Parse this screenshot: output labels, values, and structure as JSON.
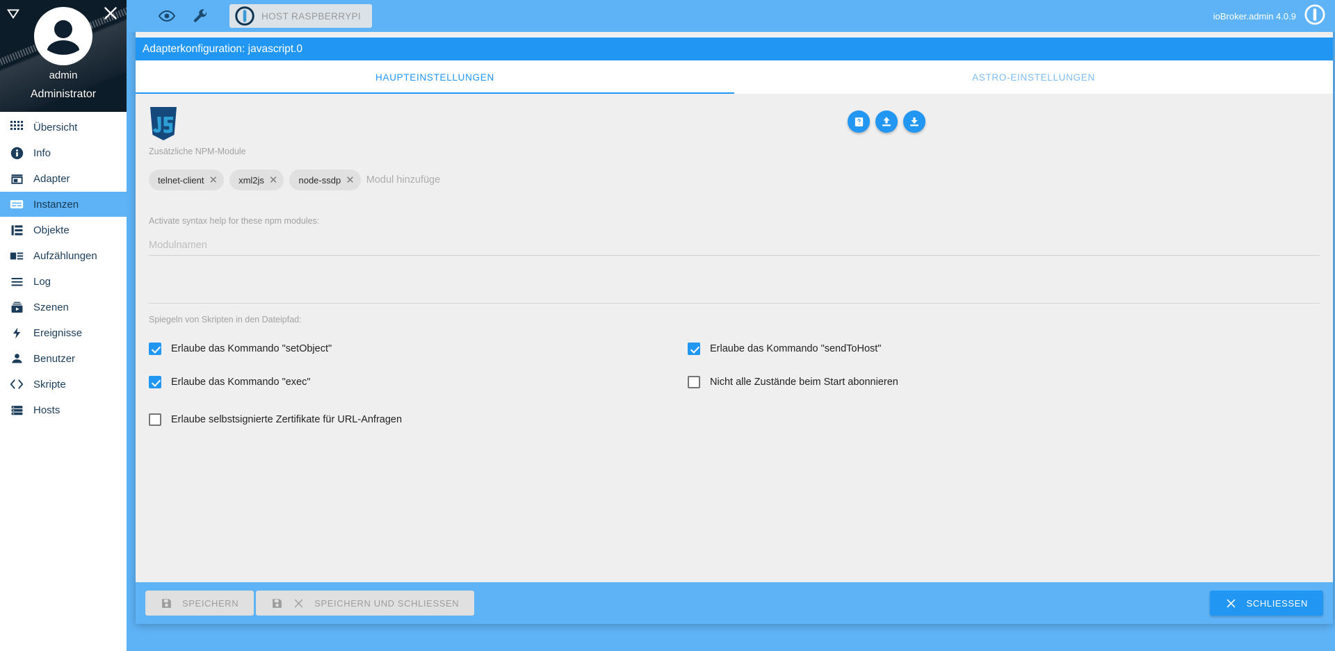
{
  "sidebar": {
    "user": {
      "name": "admin",
      "role": "Administrator"
    },
    "collapse_icon": "triangle-down-icon",
    "close_icon": "close-icon",
    "avatar_icon": "user-avatar-icon",
    "items": [
      {
        "label": "Übersicht",
        "icon": "grid-icon",
        "active": false
      },
      {
        "label": "Info",
        "icon": "info-icon",
        "active": false
      },
      {
        "label": "Adapter",
        "icon": "store-icon",
        "active": false
      },
      {
        "label": "Instanzen",
        "icon": "instances-icon",
        "active": true
      },
      {
        "label": "Objekte",
        "icon": "list-table-icon",
        "active": false
      },
      {
        "label": "Aufzählungen",
        "icon": "enum-icon",
        "active": false
      },
      {
        "label": "Log",
        "icon": "lines-icon",
        "active": false
      },
      {
        "label": "Szenen",
        "icon": "scenes-play-icon",
        "active": false
      },
      {
        "label": "Ereignisse",
        "icon": "bolt-icon",
        "active": false
      },
      {
        "label": "Benutzer",
        "icon": "person-icon",
        "active": false
      },
      {
        "label": "Skripte",
        "icon": "code-brackets-icon",
        "active": false
      },
      {
        "label": "Hosts",
        "icon": "server-icon",
        "active": false
      }
    ]
  },
  "topbar": {
    "eye_icon": "eye-icon",
    "wrench_icon": "wrench-icon",
    "host_chip_label": "HOST RASPBERRYPI",
    "host_chip_icon": "iobroker-logo-icon",
    "version": "ioBroker.admin 4.0.9",
    "logo_icon": "iobroker-logo-icon"
  },
  "dialog": {
    "title": "Adapterkonfiguration: javascript.0",
    "tabs": [
      {
        "label": "HAUPTEINSTELLUNGEN",
        "active": true
      },
      {
        "label": "ASTRO-EINSTELLUNGEN",
        "active": false
      }
    ],
    "adapter_logo_icon": "javascript-logo-icon",
    "round_buttons": [
      {
        "icon": "book-help-icon",
        "name": "help-button"
      },
      {
        "icon": "upload-icon",
        "name": "upload-button"
      },
      {
        "icon": "download-icon",
        "name": "download-button"
      }
    ],
    "npm_modules": {
      "label": "Zusätzliche NPM-Module",
      "chips": [
        "telnet-client",
        "xml2js",
        "node-ssdp"
      ],
      "input_placeholder": "Modul hinzufüge",
      "chip_remove_icon": "close-icon"
    },
    "syntax_help": {
      "label": "Activate syntax help for these npm modules:",
      "input_placeholder": "Modulnamen",
      "input_value": ""
    },
    "mirror": {
      "label": "Spiegeln von Skripten in den Dateipfad:"
    },
    "checkboxes": [
      {
        "label": "Erlaube das Kommando \"setObject\"",
        "checked": true,
        "name": "checkbox-setobject"
      },
      {
        "label": "Erlaube das Kommando \"sendToHost\"",
        "checked": true,
        "name": "checkbox-sendtohost"
      },
      {
        "label": "Erlaube das Kommando \"exec\"",
        "checked": true,
        "name": "checkbox-exec"
      },
      {
        "label": "Nicht alle Zustände beim Start abonnieren",
        "checked": false,
        "name": "checkbox-subscribe"
      }
    ],
    "checkbox_single": {
      "label": "Erlaube selbstsignierte Zertifikate für URL-Anfragen",
      "checked": false,
      "name": "checkbox-selfsigned"
    },
    "footer": {
      "save": {
        "label": "SPEICHERN",
        "icon": "save-icon"
      },
      "save_close": {
        "label": "SPEICHERN UND SCHLIESSEN",
        "icon": "save-icon",
        "icon2": "close-icon"
      },
      "close": {
        "label": "SCHLIESSEN",
        "icon": "close-icon"
      }
    }
  },
  "colors": {
    "accent": "#2196f3",
    "header_blue": "#5eb3f7",
    "sidebar_text": "#1c3d5a",
    "dialog_bg": "#efefef"
  }
}
